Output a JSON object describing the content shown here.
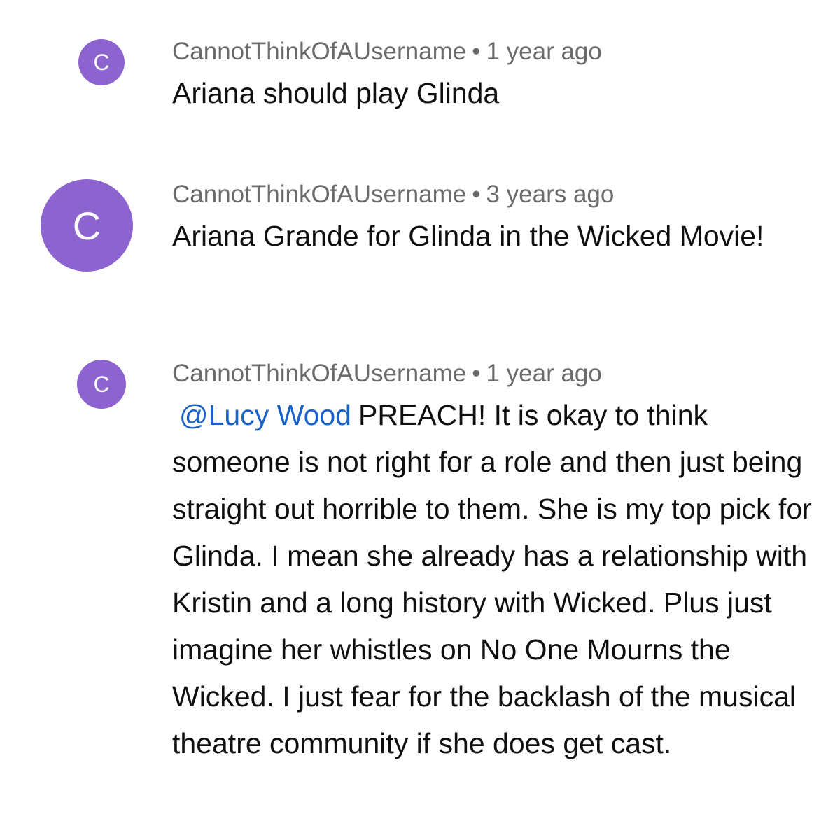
{
  "comments": [
    {
      "avatar_letter": "C",
      "author": "CannotThinkOfAUsername",
      "separator": "•",
      "time": "1 year ago",
      "mention": "",
      "text": "Ariana should play Glinda"
    },
    {
      "avatar_letter": "C",
      "author": "CannotThinkOfAUsername",
      "separator": "•",
      "time": "3 years ago",
      "mention": "",
      "text": "Ariana Grande for Glinda in the Wicked Movie!"
    },
    {
      "avatar_letter": "C",
      "author": "CannotThinkOfAUsername",
      "separator": "•",
      "time": "1 year ago",
      "mention": "@Lucy Wood",
      "text": "PREACH! It is okay to think someone is not right for a role and then just being straight out horrible to them. She is my top pick for Glinda. I mean she already has a relationship with Kristin and a long history with Wicked. Plus just imagine her whistles on No One Mourns the Wicked. I just fear for the backlash of the musical theatre community if she does get cast."
    }
  ],
  "colors": {
    "avatar": "#8d63cf",
    "mention": "#1a62c8",
    "meta": "#6b6b6b",
    "text": "#0f0f0f"
  }
}
